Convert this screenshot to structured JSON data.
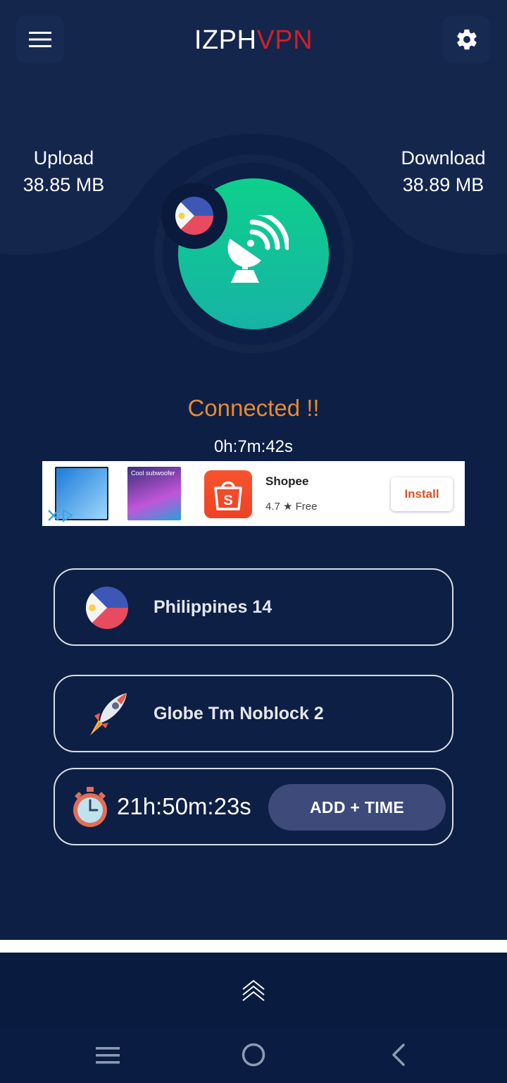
{
  "header": {
    "title_part1": "IZPH",
    "title_part2": "VPN",
    "menu_icon": "hamburger-menu-icon",
    "settings_icon": "gear-icon"
  },
  "stats": {
    "upload_label": "Upload",
    "upload_value": "38.85 MB",
    "download_label": "Download",
    "download_value": "38.89 MB"
  },
  "connection": {
    "button_icon": "satellite-dish-icon",
    "status": "Connected !!",
    "elapsed": "0h:7m:42s"
  },
  "ad": {
    "app_name": "Shopee",
    "rating_meta": "4.7 ★  Free",
    "install_label": "Install",
    "thumb2_caption": "Cool subwoofer"
  },
  "server": {
    "label": "Philippines 14",
    "icon": "philippines-flag-icon"
  },
  "network": {
    "label": "Globe Tm Noblock 2",
    "icon": "rocket-icon"
  },
  "time": {
    "remaining": "21h:50m:23s",
    "add_label": "ADD + TIME",
    "icon": "stopwatch-icon"
  },
  "bottom": {
    "expand_icon": "double-chevron-up-icon"
  },
  "nav": {
    "recents_icon": "recents-icon",
    "home_icon": "home-circle-icon",
    "back_icon": "back-chevron-icon"
  },
  "colors": {
    "background": "#0d1f44",
    "accent_red": "#d31e26",
    "status_orange": "#e88a2e",
    "connect_green": "#0ed08c"
  }
}
